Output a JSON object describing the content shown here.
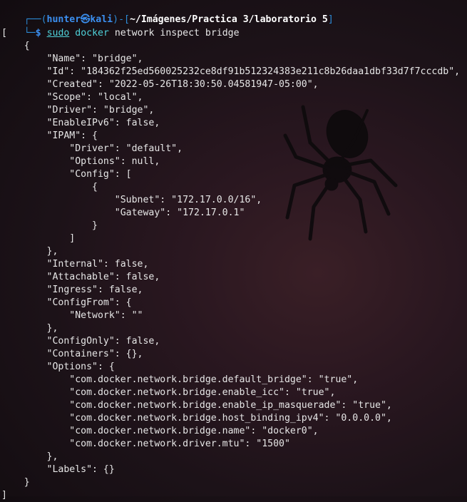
{
  "prompt": {
    "frame_top_left": "┌──(",
    "user_host": "hunter㉿kali",
    "frame_mid": ")-[",
    "path": "~/Imágenes/Practica 3/laboratorio 5",
    "frame_end": "]",
    "frame_bottom": "└─",
    "dollar": "$",
    "cmd_sudo": "sudo",
    "cmd_docker": "docker",
    "cmd_args": " network inspect bridge"
  },
  "output_lines": [
    "[",
    "    {",
    "        \"Name\": \"bridge\",",
    "        \"Id\": \"184362f25ed560025232ce8df91b512324383e211c8b26daa1dbf33d7f7cccdb\",",
    "        \"Created\": \"2022-05-26T18:30:50.04581947-05:00\",",
    "        \"Scope\": \"local\",",
    "        \"Driver\": \"bridge\",",
    "        \"EnableIPv6\": false,",
    "        \"IPAM\": {",
    "            \"Driver\": \"default\",",
    "            \"Options\": null,",
    "            \"Config\": [",
    "                {",
    "                    \"Subnet\": \"172.17.0.0/16\",",
    "                    \"Gateway\": \"172.17.0.1\"",
    "                }",
    "            ]",
    "        },",
    "        \"Internal\": false,",
    "        \"Attachable\": false,",
    "        \"Ingress\": false,",
    "        \"ConfigFrom\": {",
    "            \"Network\": \"\"",
    "        },",
    "        \"ConfigOnly\": false,",
    "        \"Containers\": {},",
    "        \"Options\": {",
    "            \"com.docker.network.bridge.default_bridge\": \"true\",",
    "            \"com.docker.network.bridge.enable_icc\": \"true\",",
    "            \"com.docker.network.bridge.enable_ip_masquerade\": \"true\",",
    "            \"com.docker.network.bridge.host_binding_ipv4\": \"0.0.0.0\",",
    "            \"com.docker.network.bridge.name\": \"docker0\",",
    "            \"com.docker.network.driver.mtu\": \"1500\"",
    "        },",
    "        \"Labels\": {}",
    "    }",
    "]"
  ],
  "background_icon": "spider-icon",
  "colors": {
    "prompt_blue": "#3b8ff0",
    "command_cyan": "#4fd1d9",
    "text": "#e6e6e6"
  }
}
